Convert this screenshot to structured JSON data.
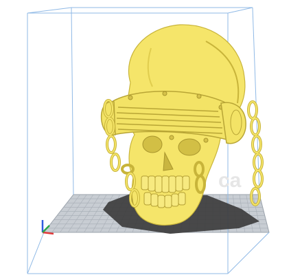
{
  "viewport": {
    "background": "#ffffff",
    "build_volume_color": "#8fb9e6",
    "bed_color": "#c8cdd3",
    "bed_grid_color": "#9aa2ab",
    "shadow_color": "#3a3a3a",
    "model_color": "#f5e56a",
    "model_edge_color": "#c8b43a",
    "axis_colors": {
      "x": "#e23a3a",
      "y": "#2ba84a",
      "z": "#2f5be0"
    },
    "watermark": "ca"
  },
  "model": {
    "name": "skull-with-goggles-and-chains",
    "icon": "skull-model"
  }
}
